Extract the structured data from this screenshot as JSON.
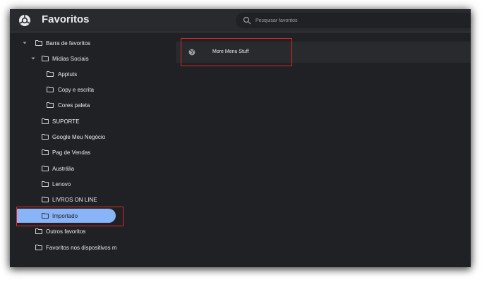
{
  "header": {
    "title": "Favoritos",
    "logo_icon": "bookmarks-logo-icon",
    "search": {
      "placeholder": "Pesquisar favoritos",
      "value": ""
    }
  },
  "tree": {
    "items": [
      {
        "label": "Barra de favoritos",
        "expanded": true
      },
      {
        "label": "Mídias Sociais",
        "expanded": true
      },
      {
        "label": "Apptuts"
      },
      {
        "label": "Copy e escrita"
      },
      {
        "label": "Cores paleta"
      },
      {
        "label": "SUPORTE"
      },
      {
        "label": "Google Meu Negócio"
      },
      {
        "label": "Pag de Vendas"
      },
      {
        "label": "Austrália"
      },
      {
        "label": "Lenovo"
      },
      {
        "label": "LIVROS ON LINE"
      },
      {
        "label": "Importado",
        "selected": true
      },
      {
        "label": "Outros favoritos"
      },
      {
        "label": "Favoritos nos dispositivos m"
      }
    ]
  },
  "list": {
    "items": [
      {
        "label": "More Menu Stuff",
        "icon": "globe-icon"
      }
    ]
  },
  "colors": {
    "background": "#202124",
    "toolbar": "#292a2d",
    "selection": "#8ab4f8",
    "highlight": "#e02424"
  }
}
